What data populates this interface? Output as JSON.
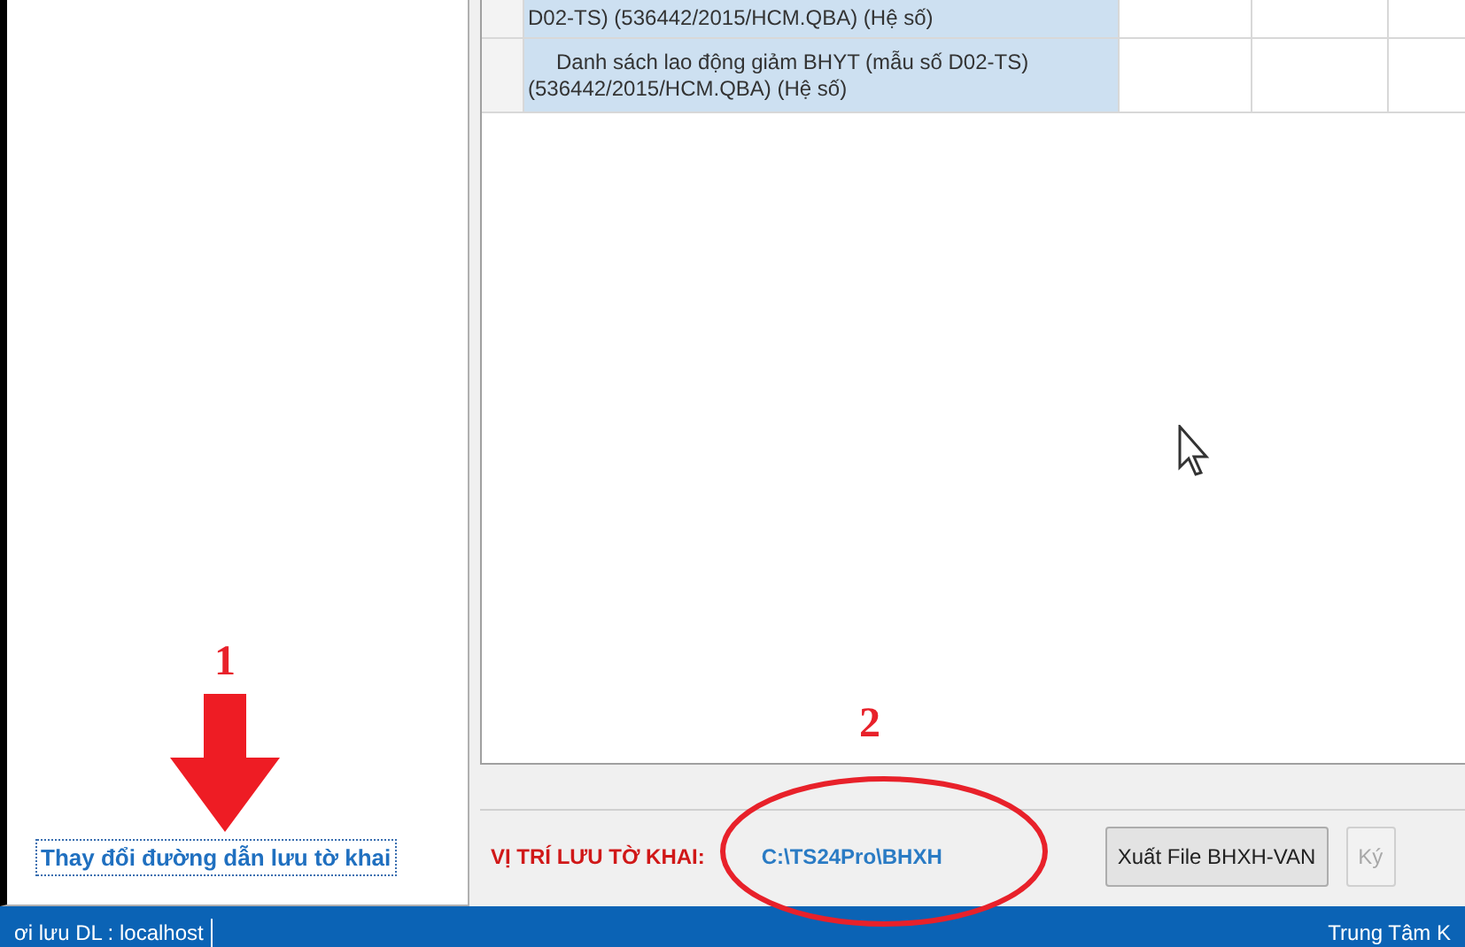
{
  "table": {
    "rows": [
      {
        "name": "D02-TS) (536442/2015/HCM.QBA) (Hệ số)",
        "selected": true
      },
      {
        "name": "Danh sách lao động giảm BHYT (mẫu số D02-TS) (536442/2015/HCM.QBA) (Hệ số)",
        "selected": true
      }
    ]
  },
  "sidebar": {
    "link": "Thay đổi đường dẫn lưu tờ khai"
  },
  "save_location": {
    "label": "VỊ TRÍ LƯU TỜ KHAI:",
    "path": "C:\\TS24Pro\\BHXH"
  },
  "buttons": [
    {
      "label": "Xuất File BHXH-VAN",
      "disabled": false
    },
    {
      "label": "Ký",
      "disabled": true
    }
  ],
  "status_bar": {
    "left": "ơi lưu DL : localhost",
    "right": "Trung Tâm K"
  },
  "annotations": [
    {
      "kind": "arrow",
      "label": "1"
    },
    {
      "kind": "ellipse",
      "label": "2"
    }
  ]
}
